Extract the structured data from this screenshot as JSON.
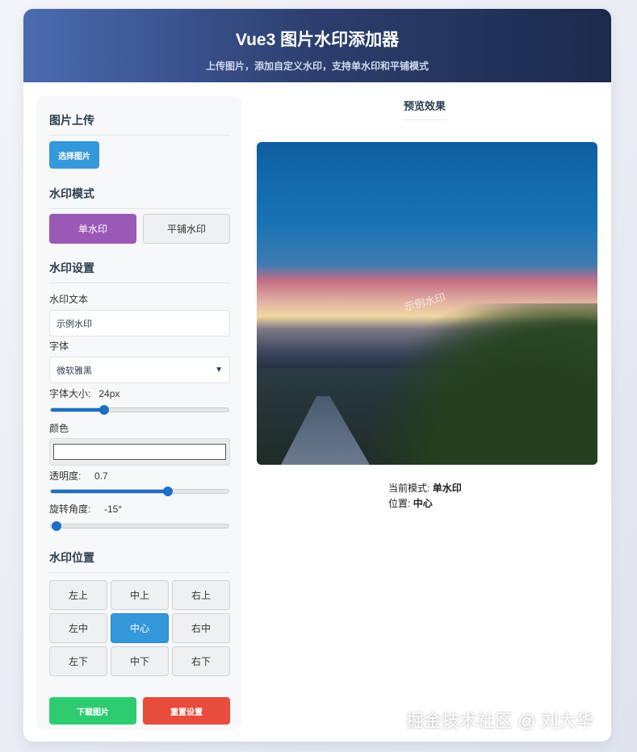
{
  "header": {
    "title": "Vue3 图片水印添加器",
    "subtitle": "上传图片，添加自定义水印，支持单水印和平铺模式"
  },
  "upload": {
    "section": "图片上传",
    "button": "选择图片"
  },
  "mode": {
    "section": "水印模式",
    "single": "单水印",
    "tile": "平铺水印",
    "selected": "single"
  },
  "settings": {
    "section": "水印设置",
    "text_label": "水印文本",
    "text_value": "示例水印",
    "font_label": "字体",
    "font_value": "微软雅黑",
    "size_label": "字体大小:",
    "size_value": "24px",
    "size_fraction": 0.3,
    "color_label": "颜色",
    "color_value": "#ffffff",
    "opacity_label": "透明度:",
    "opacity_value": "0.7",
    "opacity_fraction": 0.66,
    "rotation_label": "旋转角度:",
    "rotation_value": "-15°",
    "rotation_fraction": 0.0
  },
  "position": {
    "section": "水印位置",
    "items": [
      "左上",
      "中上",
      "右上",
      "左中",
      "中心",
      "右中",
      "左下",
      "中下",
      "右下"
    ],
    "active": "中心"
  },
  "actions": {
    "download": "下载图片",
    "reset": "重置设置"
  },
  "preview": {
    "title": "预览效果",
    "watermark_text": "示例水印",
    "mode_label": "当前模式:",
    "mode_value": "单水印",
    "position_label": "位置:",
    "position_value": "中心"
  },
  "colors": {
    "purple": "#9b59b6",
    "blue": "#3498db",
    "green": "#2ecc71",
    "red": "#e74c3c"
  },
  "site_watermark": "掘金技术社区 @ 刘大华"
}
